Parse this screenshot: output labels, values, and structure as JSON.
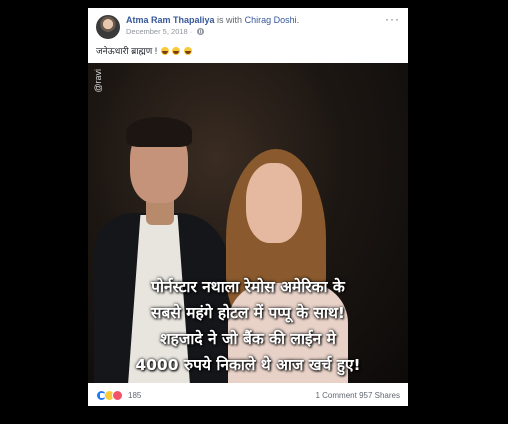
{
  "post": {
    "author_name": "Atma Ram Thapaliya",
    "with_text": "is with",
    "tagged_name": "Chirag Doshi.",
    "date": "December 5, 2018 ·",
    "caption": "जनेऊधारी ब्राह्मण !",
    "more_label": "···"
  },
  "photo": {
    "watermark": "@ravi",
    "overlay_lines": [
      "पोर्नस्टार नथाला रेमोस अमेरिका के",
      "सबसे महंगे होटल में पप्पू के साथ!",
      "शहजादे ने जो बैंक की लाईन मे",
      "4000 रुपये निकाले थे आज खर्च हुए!"
    ]
  },
  "footer": {
    "reaction_count": "185",
    "comments": "1 Comment",
    "shares": "957 Shares"
  },
  "icons": {
    "reactions": [
      "like-icon",
      "haha-icon",
      "love-icon"
    ],
    "globe": "globe-icon",
    "emoji": "laughing-emoji-icon"
  },
  "colors": {
    "link": "#365899",
    "like": "#2078f4",
    "haha": "#f7c93b",
    "love": "#f25268",
    "background": "#000000"
  }
}
